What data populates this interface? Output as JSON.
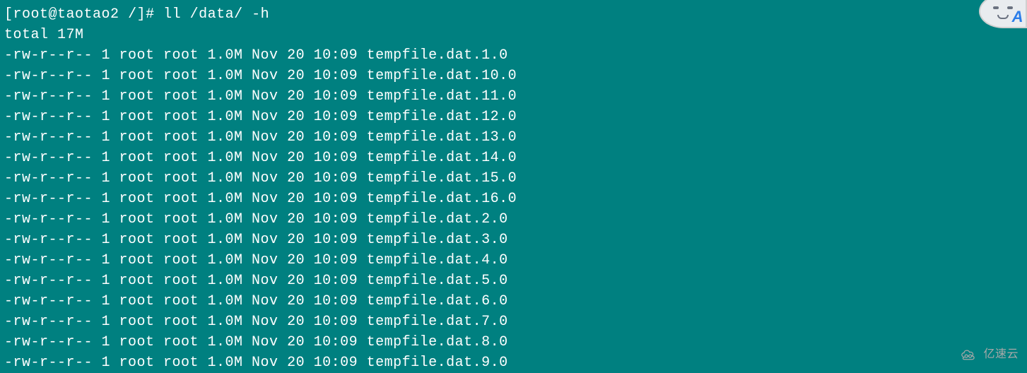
{
  "prompt": {
    "user": "root",
    "host": "taotao2",
    "cwd": "/",
    "symbol": "#",
    "command": "ll /data/ -h"
  },
  "total_line": "total 17M",
  "files": [
    {
      "perms": "-rw-r--r--",
      "links": "1",
      "owner": "root",
      "group": "root",
      "size": "1.0M",
      "month": "Nov",
      "day": "20",
      "time": "10:09",
      "name": "tempfile.dat.1.0"
    },
    {
      "perms": "-rw-r--r--",
      "links": "1",
      "owner": "root",
      "group": "root",
      "size": "1.0M",
      "month": "Nov",
      "day": "20",
      "time": "10:09",
      "name": "tempfile.dat.10.0"
    },
    {
      "perms": "-rw-r--r--",
      "links": "1",
      "owner": "root",
      "group": "root",
      "size": "1.0M",
      "month": "Nov",
      "day": "20",
      "time": "10:09",
      "name": "tempfile.dat.11.0"
    },
    {
      "perms": "-rw-r--r--",
      "links": "1",
      "owner": "root",
      "group": "root",
      "size": "1.0M",
      "month": "Nov",
      "day": "20",
      "time": "10:09",
      "name": "tempfile.dat.12.0"
    },
    {
      "perms": "-rw-r--r--",
      "links": "1",
      "owner": "root",
      "group": "root",
      "size": "1.0M",
      "month": "Nov",
      "day": "20",
      "time": "10:09",
      "name": "tempfile.dat.13.0"
    },
    {
      "perms": "-rw-r--r--",
      "links": "1",
      "owner": "root",
      "group": "root",
      "size": "1.0M",
      "month": "Nov",
      "day": "20",
      "time": "10:09",
      "name": "tempfile.dat.14.0"
    },
    {
      "perms": "-rw-r--r--",
      "links": "1",
      "owner": "root",
      "group": "root",
      "size": "1.0M",
      "month": "Nov",
      "day": "20",
      "time": "10:09",
      "name": "tempfile.dat.15.0"
    },
    {
      "perms": "-rw-r--r--",
      "links": "1",
      "owner": "root",
      "group": "root",
      "size": "1.0M",
      "month": "Nov",
      "day": "20",
      "time": "10:09",
      "name": "tempfile.dat.16.0"
    },
    {
      "perms": "-rw-r--r--",
      "links": "1",
      "owner": "root",
      "group": "root",
      "size": "1.0M",
      "month": "Nov",
      "day": "20",
      "time": "10:09",
      "name": "tempfile.dat.2.0"
    },
    {
      "perms": "-rw-r--r--",
      "links": "1",
      "owner": "root",
      "group": "root",
      "size": "1.0M",
      "month": "Nov",
      "day": "20",
      "time": "10:09",
      "name": "tempfile.dat.3.0"
    },
    {
      "perms": "-rw-r--r--",
      "links": "1",
      "owner": "root",
      "group": "root",
      "size": "1.0M",
      "month": "Nov",
      "day": "20",
      "time": "10:09",
      "name": "tempfile.dat.4.0"
    },
    {
      "perms": "-rw-r--r--",
      "links": "1",
      "owner": "root",
      "group": "root",
      "size": "1.0M",
      "month": "Nov",
      "day": "20",
      "time": "10:09",
      "name": "tempfile.dat.5.0"
    },
    {
      "perms": "-rw-r--r--",
      "links": "1",
      "owner": "root",
      "group": "root",
      "size": "1.0M",
      "month": "Nov",
      "day": "20",
      "time": "10:09",
      "name": "tempfile.dat.6.0"
    },
    {
      "perms": "-rw-r--r--",
      "links": "1",
      "owner": "root",
      "group": "root",
      "size": "1.0M",
      "month": "Nov",
      "day": "20",
      "time": "10:09",
      "name": "tempfile.dat.7.0"
    },
    {
      "perms": "-rw-r--r--",
      "links": "1",
      "owner": "root",
      "group": "root",
      "size": "1.0M",
      "month": "Nov",
      "day": "20",
      "time": "10:09",
      "name": "tempfile.dat.8.0"
    },
    {
      "perms": "-rw-r--r--",
      "links": "1",
      "owner": "root",
      "group": "root",
      "size": "1.0M",
      "month": "Nov",
      "day": "20",
      "time": "10:09",
      "name": "tempfile.dat.9.0"
    }
  ],
  "watermark": {
    "text": "亿速云"
  },
  "avatar": {
    "letter": "A"
  }
}
